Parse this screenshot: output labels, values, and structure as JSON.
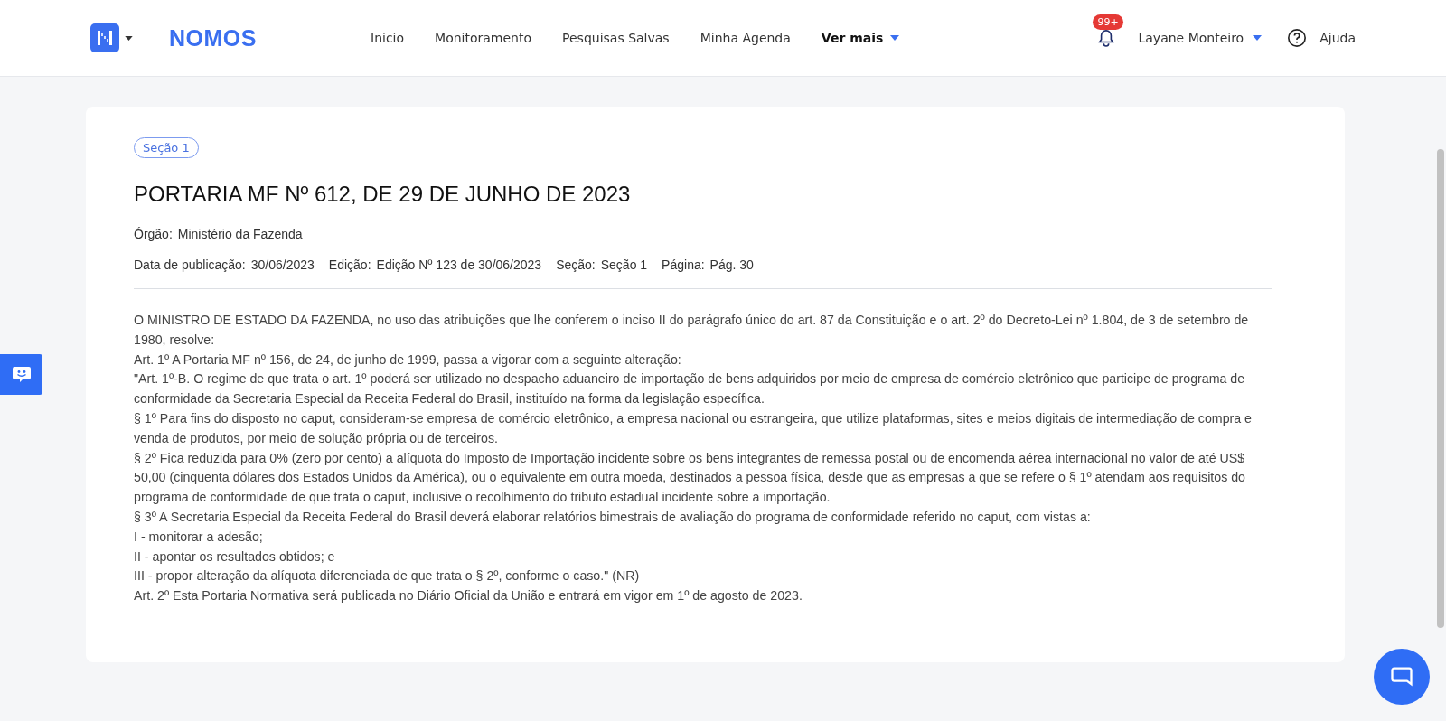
{
  "header": {
    "brand": "NOMOS",
    "nav": [
      {
        "label": "Inicio",
        "kind": "link"
      },
      {
        "label": "Monitoramento",
        "kind": "link"
      },
      {
        "label": "Pesquisas Salvas",
        "kind": "link"
      },
      {
        "label": "Minha Agenda",
        "kind": "link"
      },
      {
        "label": "Ver mais",
        "kind": "dropdown"
      }
    ],
    "notifications_badge": "99+",
    "user": "Layane Monteiro",
    "help": "Ajuda"
  },
  "document": {
    "section_tag": "Seção 1",
    "title": "PORTARIA MF Nº 612, DE 29 DE JUNHO DE 2023",
    "meta_rows": [
      [
        {
          "label": "Órgão:",
          "value": "Ministério da Fazenda"
        }
      ],
      [
        {
          "label": "Data de publicação:",
          "value": "30/06/2023"
        },
        {
          "label": "Edição:",
          "value": "Edição Nº 123 de 30/06/2023"
        },
        {
          "label": "Seção:",
          "value": "Seção 1"
        },
        {
          "label": "Página:",
          "value": "Pág. 30"
        }
      ]
    ],
    "paragraphs": [
      "O MINISTRO DE ESTADO DA FAZENDA, no uso das atribuições que lhe conferem o inciso II do parágrafo único do art. 87 da Constituição e o art. 2º do Decreto-Lei nº 1.804, de 3 de setembro de 1980, resolve:",
      "Art. 1º A Portaria MF nº 156, de 24, de junho de 1999, passa a vigorar com a seguinte alteração:",
      "\"Art. 1º-B. O regime de que trata o art. 1º poderá ser utilizado no despacho aduaneiro de importação de bens adquiridos por meio de empresa de comércio eletrônico que participe de programa de conformidade da Secretaria Especial da Receita Federal do Brasil, instituído na forma da legislação específica.",
      "§ 1º Para fins do disposto no caput, consideram-se empresa de comércio eletrônico, a empresa nacional ou estrangeira, que utilize plataformas, sites e meios digitais de intermediação de compra e venda de produtos, por meio de solução própria ou de terceiros.",
      "§ 2º Fica reduzida para 0% (zero por cento) a alíquota do Imposto de Importação incidente sobre os bens integrantes de remessa postal ou de encomenda aérea internacional no valor de até US$ 50,00 (cinquenta dólares dos Estados Unidos da América), ou o equivalente em outra moeda, destinados a pessoa física, desde que as empresas a que se refere o § 1º atendam aos requisitos do programa de conformidade de que trata o caput, inclusive o recolhimento do tributo estadual incidente sobre a importação.",
      "§ 3º A Secretaria Especial da Receita Federal do Brasil deverá elaborar relatórios bimestrais de avaliação do programa de conformidade referido no caput, com vistas a:",
      "I - monitorar a adesão;",
      "II - apontar os resultados obtidos; e",
      "III - propor alteração da alíquota diferenciada de que trata o § 2º, conforme o caso.\" (NR)",
      "Art. 2º Esta Portaria Normativa será publicada no Diário Oficial da União e entrará em vigor em 1º de agosto de 2023."
    ]
  }
}
